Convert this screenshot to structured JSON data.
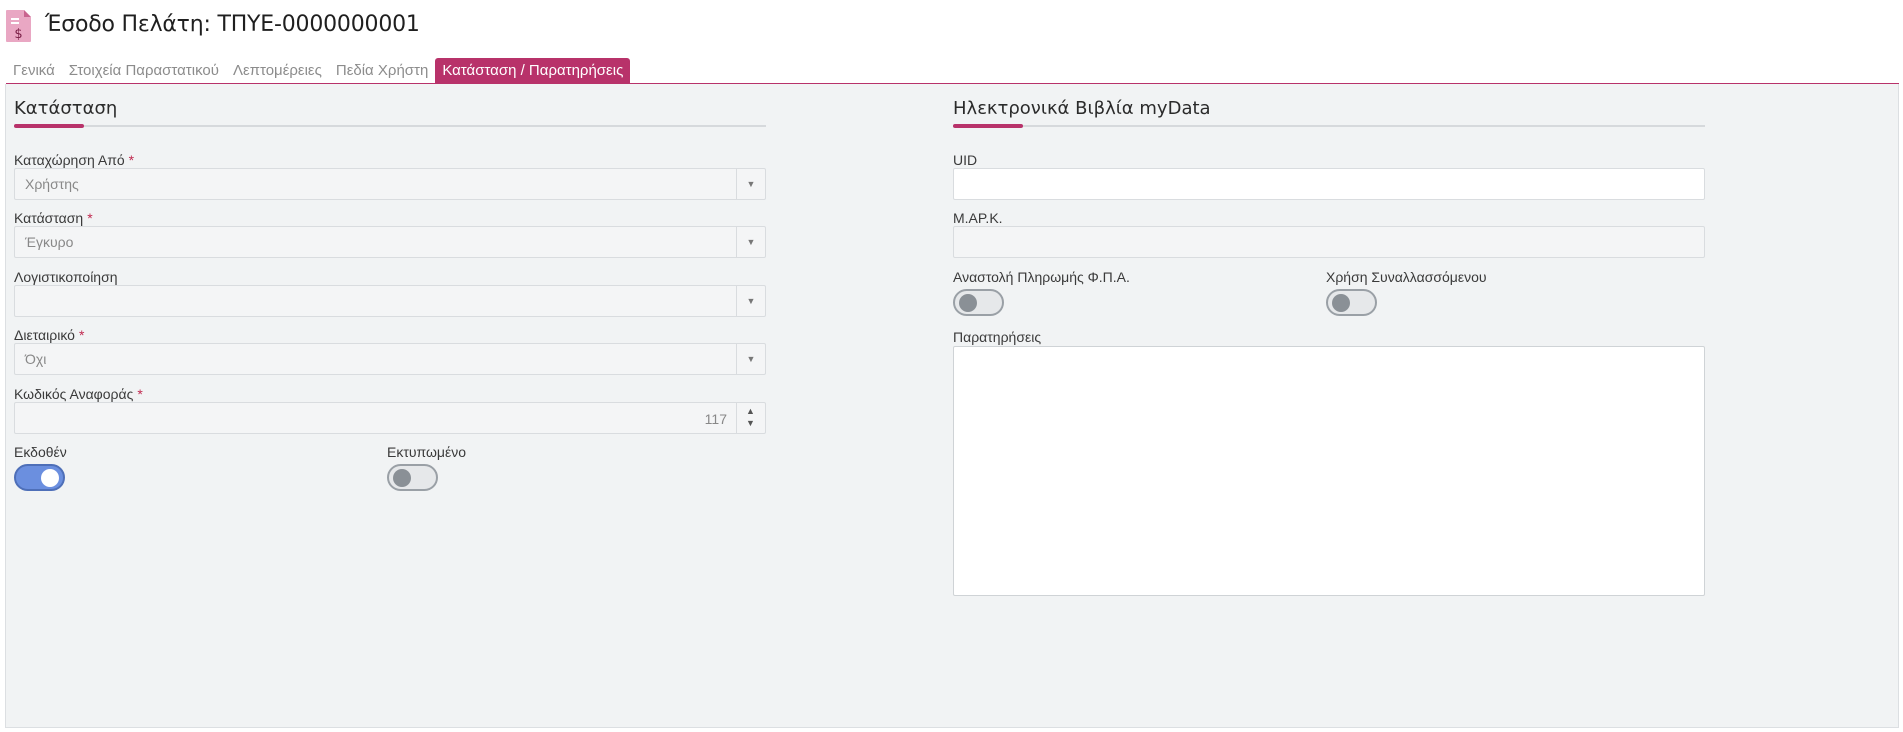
{
  "header": {
    "title": "Έσοδο Πελάτη: ΤΠΥΕ-0000000001",
    "icon": "invoice-dollar-icon"
  },
  "tabs": [
    {
      "label": "Γενικά",
      "active": false
    },
    {
      "label": "Στοιχεία Παραστατικού",
      "active": false
    },
    {
      "label": "Λεπτομέρειες",
      "active": false
    },
    {
      "label": "Πεδία Χρήστη",
      "active": false
    },
    {
      "label": "Κατάσταση / Παρατηρήσεις",
      "active": true
    }
  ],
  "status_section": {
    "title": "Κατάσταση",
    "registered_by": {
      "label": "Καταχώρηση Από",
      "required": "*",
      "value": "Χρήστης"
    },
    "status": {
      "label": "Κατάσταση",
      "required": "*",
      "value": "Έγκυρο"
    },
    "accounting": {
      "label": "Λογιστικοποίηση",
      "value": ""
    },
    "intercompany": {
      "label": "Διεταιρικό",
      "required": "*",
      "value": "Όχι"
    },
    "reference_code": {
      "label": "Κωδικός Αναφοράς",
      "required": "*",
      "value": "117"
    },
    "issued": {
      "label": "Εκδοθέν",
      "on": true
    },
    "printed": {
      "label": "Εκτυπωμένο",
      "on": false
    }
  },
  "mydata_section": {
    "title": "Ηλεκτρονικά Βιβλία myData",
    "uid": {
      "label": "UID",
      "value": ""
    },
    "mark": {
      "label": "Μ.ΑΡ.Κ.",
      "value": ""
    },
    "vat_suspension": {
      "label": "Αναστολή Πληρωμής Φ.Π.Α.",
      "on": false
    },
    "counterparty_use": {
      "label": "Χρήση Συναλλασσόμενου",
      "on": false
    },
    "notes": {
      "label": "Παρατηρήσεις",
      "value": ""
    }
  },
  "colors": {
    "accent": "#b8326a",
    "toggle_on": "#6b8fdf",
    "panel_bg": "#f1f3f4"
  }
}
